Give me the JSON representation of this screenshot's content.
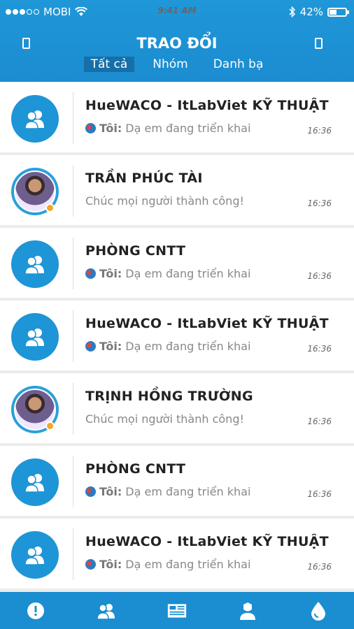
{
  "status_bar": {
    "carrier": "MOBI",
    "time": "9:41 AM",
    "battery": "42%"
  },
  "header": {
    "title": "TRAO ĐỔI"
  },
  "tabs": [
    {
      "label": "Tất cả",
      "active": true
    },
    {
      "label": "Nhóm",
      "active": false
    },
    {
      "label": "Danh bạ",
      "active": false
    }
  ],
  "conversations": [
    {
      "name": "HueWACO - ItLabViet KỸ THUẬT",
      "sender": "Tôi:",
      "message": "Dạ em đang triển khai",
      "time": "16:36",
      "type": "group"
    },
    {
      "name": "TRẦN PHÚC TÀI",
      "sender": "",
      "message": "Chúc mọi người thành công!",
      "time": "16:36",
      "type": "person"
    },
    {
      "name": "PHÒNG CNTT",
      "sender": "Tôi:",
      "message": "Dạ em đang triển khai",
      "time": "16:36",
      "type": "group"
    },
    {
      "name": "HueWACO - ItLabViet KỸ THUẬT",
      "sender": "Tôi:",
      "message": "Dạ em đang triển khai",
      "time": "16:36",
      "type": "group"
    },
    {
      "name": "TRỊNH HỒNG TRƯỜNG",
      "sender": "",
      "message": "Chúc mọi người thành công!",
      "time": "16:36",
      "type": "person"
    },
    {
      "name": "PHÒNG CNTT",
      "sender": "Tôi:",
      "message": "Dạ em đang triển khai",
      "time": "16:36",
      "type": "group"
    },
    {
      "name": "HueWACO - ItLabViet KỸ THUẬT",
      "sender": "Tôi:",
      "message": "Dạ em đang triển khai",
      "time": "16:36",
      "type": "group"
    }
  ],
  "bottom_tabs": [
    "alert-icon",
    "contacts-icon",
    "news-icon",
    "profile-icon",
    "water-drop-icon"
  ],
  "colors": {
    "primary": "#1b8dd1",
    "online": "#f5a623"
  }
}
